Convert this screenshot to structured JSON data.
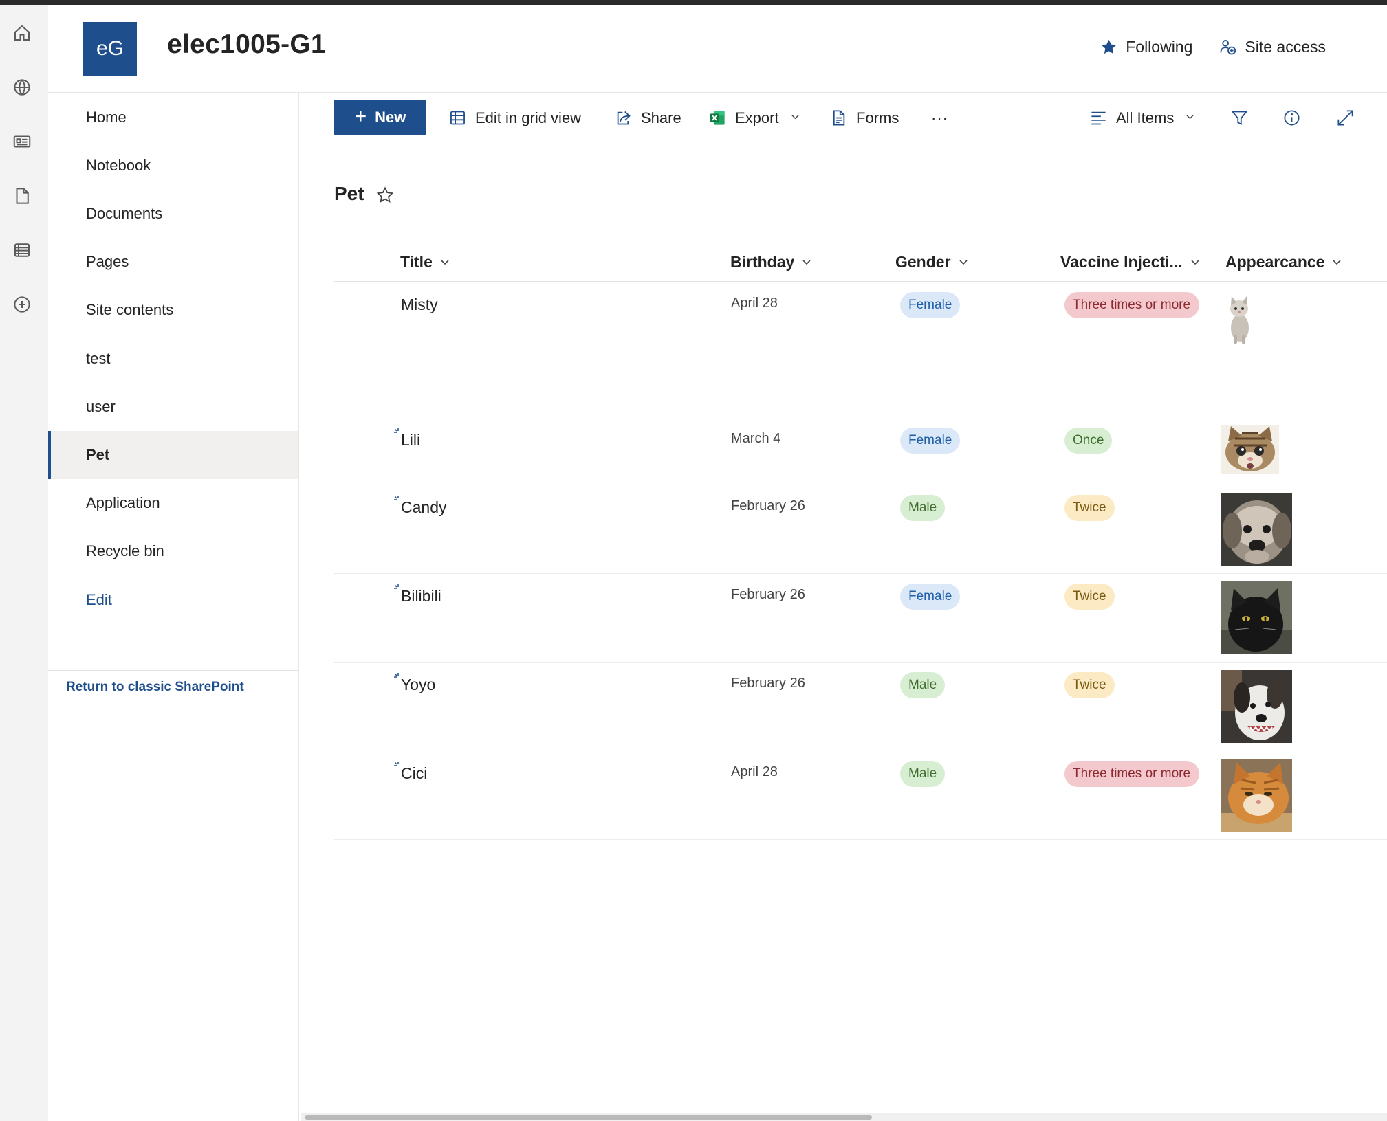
{
  "site": {
    "logo_text": "eG",
    "title": "elec1005-G1",
    "following_label": "Following",
    "site_access_label": "Site access"
  },
  "nav": {
    "items": [
      {
        "label": "Home"
      },
      {
        "label": "Notebook"
      },
      {
        "label": "Documents"
      },
      {
        "label": "Pages"
      },
      {
        "label": "Site contents"
      },
      {
        "label": "test"
      },
      {
        "label": "user"
      },
      {
        "label": "Pet",
        "active": true
      },
      {
        "label": "Application"
      },
      {
        "label": "Recycle bin"
      }
    ],
    "edit_label": "Edit",
    "return_label": "Return to classic SharePoint"
  },
  "commands": {
    "new_label": "New",
    "grid_label": "Edit in grid view",
    "share_label": "Share",
    "export_label": "Export",
    "forms_label": "Forms",
    "more_label": "···",
    "view_label": "All Items"
  },
  "list": {
    "title": "Pet",
    "columns": [
      "Title",
      "Birthday",
      "Gender",
      "Vaccine Injecti...",
      "Appearcance"
    ],
    "rows": [
      {
        "title": "Misty",
        "birthday": "April 28",
        "gender": "Female",
        "vaccine": "Three times or more",
        "appearance": "white-kitten-photo"
      },
      {
        "title": "Lili",
        "birthday": "March 4",
        "gender": "Female",
        "vaccine": "Once",
        "appearance": "tabby-kitten-photo"
      },
      {
        "title": "Candy",
        "birthday": "February 26",
        "gender": "Male",
        "vaccine": "Twice",
        "appearance": "shaggy-dog-photo"
      },
      {
        "title": "Bilibili",
        "birthday": "February 26",
        "gender": "Female",
        "vaccine": "Twice",
        "appearance": "black-cat-photo"
      },
      {
        "title": "Yoyo",
        "birthday": "February 26",
        "gender": "Male",
        "vaccine": "Twice",
        "appearance": "white-dog-photo"
      },
      {
        "title": "Cici",
        "birthday": "April 28",
        "gender": "Male",
        "vaccine": "Three times or more",
        "appearance": "orange-cat-photo"
      }
    ]
  },
  "colors": {
    "brand": "#1f4e8c",
    "female_bg": "#dbe8f8",
    "male_bg": "#d8eed3",
    "three_bg": "#f4c9cd",
    "twice_bg": "#fbeac4"
  }
}
